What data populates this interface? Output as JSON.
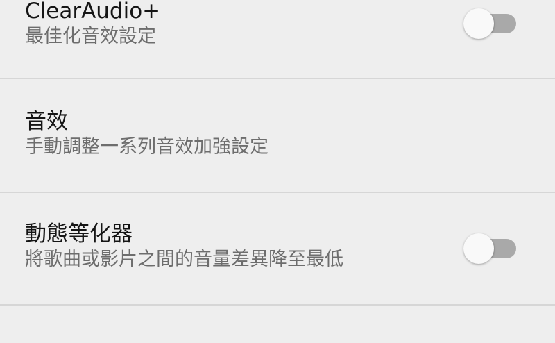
{
  "settings": {
    "items": [
      {
        "title": "ClearAudio+",
        "subtitle": "最佳化音效設定",
        "has_toggle": true,
        "toggle_on": false
      },
      {
        "title": "音效",
        "subtitle": "手動調整一系列音效加強設定",
        "has_toggle": false
      },
      {
        "title": "動態等化器",
        "subtitle": "將歌曲或影片之間的音量差異降至最低",
        "has_toggle": true,
        "toggle_on": false
      }
    ]
  },
  "colors": {
    "background": "#eeeeee",
    "title_text": "#151515",
    "subtitle_text": "#6d6d6d",
    "divider": "#d6d6d6",
    "toggle_track_off": "#a9a9a9",
    "toggle_thumb_off": "#f9f9f9"
  }
}
